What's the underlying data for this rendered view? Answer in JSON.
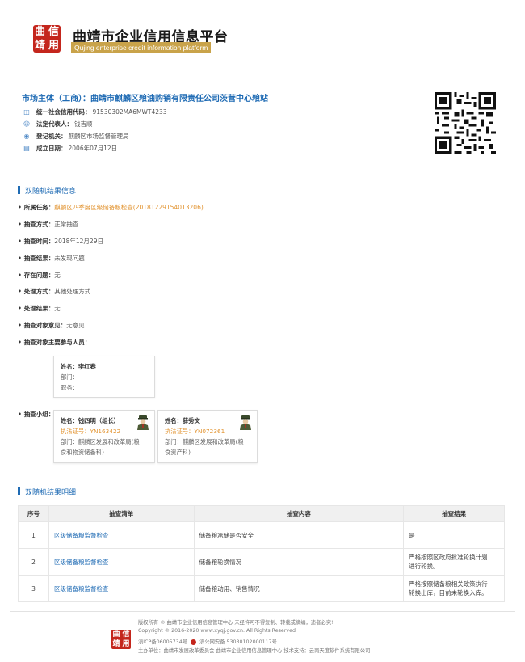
{
  "header": {
    "seal_chars": [
      "曲",
      "靖",
      "信",
      "用"
    ],
    "title_cn": "曲靖市企业信用信息平台",
    "title_en": "Qujing enterprise credit information platform"
  },
  "entity": {
    "prefix": "市场主体（工商）：",
    "name": "曲靖市麒麟区粮油购销有限责任公司茨营中心粮站",
    "fields": [
      {
        "icon": "credit-code-icon",
        "label": "统一社会信用代码：",
        "value": "91530302MA6MWT4233"
      },
      {
        "icon": "person-icon",
        "label": "法定代表人：",
        "value": "钱吉顺"
      },
      {
        "icon": "location-icon",
        "label": "登记机关：",
        "value": "麒麟区市场监督管理局"
      },
      {
        "icon": "calendar-icon",
        "label": "成立日期：",
        "value": "2006年07月12日"
      }
    ]
  },
  "section1": {
    "title": "双随机结果信息",
    "rows": [
      {
        "label": "所属任务：",
        "value": "麒麟区四季度区级储备粮检查(20181229154013206)",
        "highlight": true
      },
      {
        "label": "抽查方式：",
        "value": "正常抽查"
      },
      {
        "label": "抽查时间：",
        "value": "2018年12月29日"
      },
      {
        "label": "抽查结果：",
        "value": "未发现问题"
      },
      {
        "label": "存在问题：",
        "value": "无"
      },
      {
        "label": "处理方式：",
        "value": "其他处理方式"
      },
      {
        "label": "处理结果：",
        "value": "无"
      },
      {
        "label": "抽查对象意见：",
        "value": "无意见"
      },
      {
        "label": "抽查对象主要参与人员：",
        "value": ""
      }
    ],
    "participant": {
      "name_label": "姓名：",
      "name": "李红春",
      "dept_label": "部门：",
      "dept": "",
      "role_label": "职务：",
      "role": ""
    },
    "team_label": "抽查小组：",
    "team": [
      {
        "name_label": "姓名：",
        "name": "钱四明",
        "leader": "（组长）",
        "cert_label": "执法证号：",
        "cert": "YN163422",
        "dept_label": "部门：",
        "dept_line1": "麒麟区发展和改革局(粮",
        "dept_line2": "食和物资储备科)"
      },
      {
        "name_label": "姓名：",
        "name": "薛秀文",
        "leader": "",
        "cert_label": "执法证号：",
        "cert": "YN072361",
        "dept_label": "部门：",
        "dept_line1": "麒麟区发展和改革局(粮",
        "dept_line2": "食资产科)"
      }
    ]
  },
  "section2": {
    "title": "双随机结果明细",
    "headers": [
      "序号",
      "抽查清单",
      "抽查内容",
      "抽查结果"
    ],
    "rows": [
      {
        "no": "1",
        "item": "区级储备粮监督检查",
        "content": "储备粮承储是否安全",
        "result_l1": "是",
        "result_l2": ""
      },
      {
        "no": "2",
        "item": "区级储备粮监督检查",
        "content": "储备粮轮换情况",
        "result_l1": "严格按照区政府批准轮换计划",
        "result_l2": "进行轮换。"
      },
      {
        "no": "3",
        "item": "区级储备粮监督检查",
        "content": "储备粮动用、销售情况",
        "result_l1": "严格按照储备粮相关政策执行",
        "result_l2": "轮换出库，目前未轮换入库。"
      }
    ]
  },
  "footer": {
    "line1": "版权所有 © 曲靖市企业信用信息管理中心 未经许可不得复制、转载或摘编，违者必究!",
    "line2": "Copyright © 2016-2020 www.xyqj.gov.cn. All Rights Reserved",
    "line3_icp": "滇ICP备06005734号",
    "line3_police": "滇公网安备 53030102000117号",
    "line4": "主办单位：曲靖市发展改革委员会  曲靖市企业信用信息管理中心  技术支持：云南天度软件系统有限公司",
    "seal_chars": [
      "曲",
      "靖",
      "信",
      "用"
    ]
  },
  "colors": {
    "accent": "#1f6bb4",
    "orange": "#e2932f",
    "green": "#2ea043",
    "seal_red": "#c4261d",
    "gold": "#c9a34a"
  }
}
